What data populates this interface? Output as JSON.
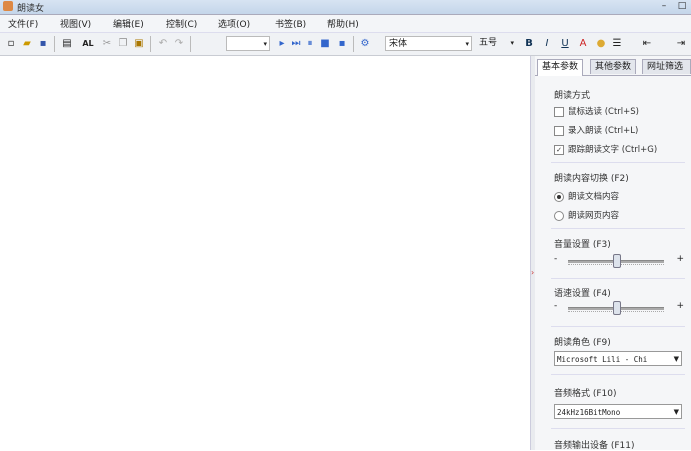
{
  "window": {
    "title": "朗读女"
  },
  "menu": [
    "文件(F)",
    "视图(V)",
    "编辑(E)",
    "控制(C)",
    "选项(O)",
    "书签(B)",
    "帮助(H)"
  ],
  "toolbar": {
    "font_name": "宋体",
    "font_size": "五号",
    "bold": "B",
    "italic": "I",
    "underline": "U",
    "font_color": "A",
    "al_label": "AL"
  },
  "tabs": [
    "基本参数",
    "其他参数",
    "网址筛选"
  ],
  "read_mode": {
    "title": "朗读方式",
    "options": [
      {
        "label": "鼠标选读 (Ctrl+S)",
        "checked": false
      },
      {
        "label": "录入朗读 (Ctrl+L)",
        "checked": false
      },
      {
        "label": "跟踪朗读文字 (Ctrl+G)",
        "checked": true
      }
    ]
  },
  "content_switch": {
    "title": "朗读内容切换 (F2)",
    "options": [
      {
        "label": "朗读文档内容",
        "selected": true
      },
      {
        "label": "朗读网页内容",
        "selected": false
      }
    ]
  },
  "volume": {
    "title": "音量设置 (F3)",
    "minus": "-",
    "plus": "+",
    "level": 0.5
  },
  "speed": {
    "title": "语速设置 (F4)",
    "minus": "-",
    "plus": "+",
    "level": 0.5
  },
  "voice": {
    "title": "朗读角色 (F9)",
    "value": "Microsoft Lili - Chi"
  },
  "audio_format": {
    "title": "音频格式 (F10)",
    "value": "24kHz16BitMono"
  },
  "audio_output": {
    "title": "音频输出设备 (F11)"
  }
}
